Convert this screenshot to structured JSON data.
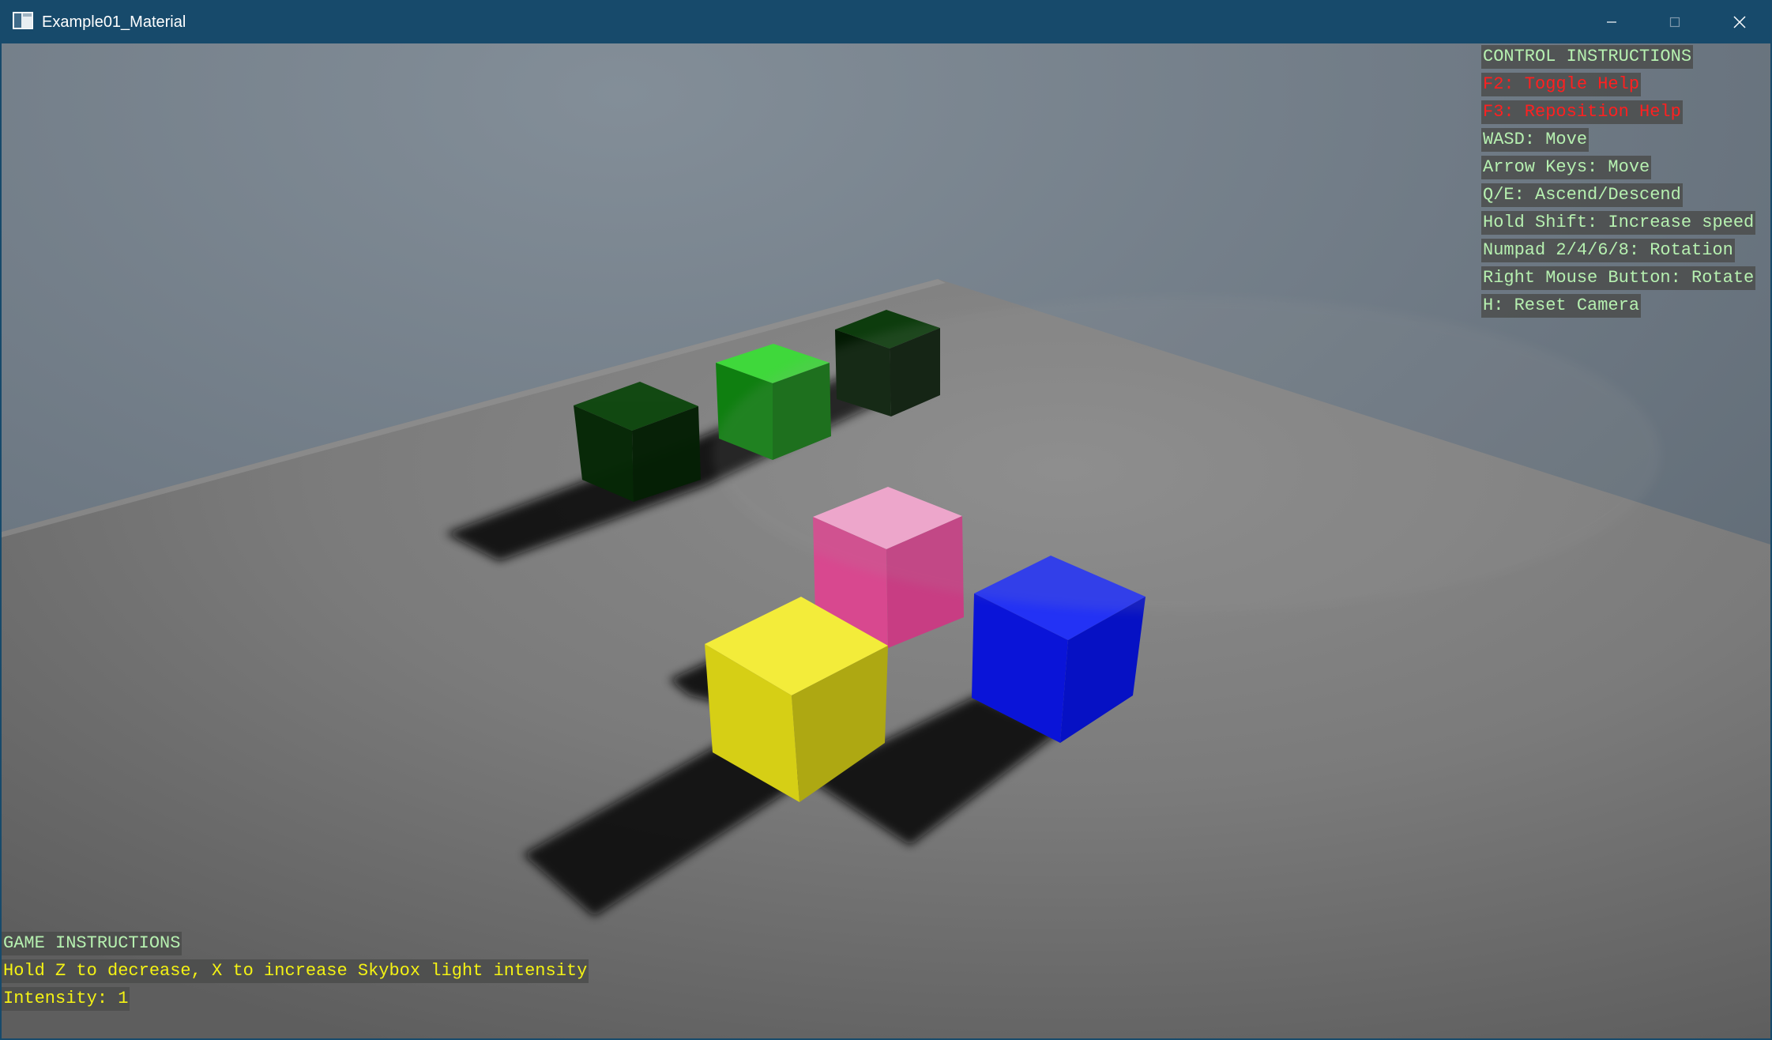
{
  "window": {
    "title": "Example01_Material",
    "controls": {
      "minimize": "minimize-icon",
      "maximize": "maximize-icon",
      "close": "close-icon"
    }
  },
  "help": {
    "heading": "CONTROL INSTRUCTIONS",
    "toggle_help": "F2: Toggle Help",
    "reposition_help": "F3: Reposition Help",
    "wasd": "WASD: Move",
    "arrows": "Arrow Keys: Move",
    "qe": "Q/E: Ascend/Descend",
    "shift": "Hold Shift: Increase speed",
    "numpad": "Numpad 2/4/6/8: Rotation",
    "rmb": "Right Mouse Button: Rotate",
    "reset": "H: Reset Camera"
  },
  "game": {
    "heading": "GAME INSTRUCTIONS",
    "instruction": "Hold Z to decrease, X to increase Skybox light intensity",
    "intensity": "Intensity: 1"
  },
  "colors": {
    "titlebar": "#174a6b",
    "sky": "#6c7781",
    "floor": "#808080",
    "hud_text": "#b6f0b0",
    "hud_red": "#ff2020",
    "hud_yellow": "#f4f214",
    "cube_pink": "#f7a3cf",
    "cube_yellow": "#f2e93a",
    "cube_blue": "#1f2ef2",
    "cube_green": "#3ed43a",
    "cube_dark_green": "#0c3a0c"
  }
}
